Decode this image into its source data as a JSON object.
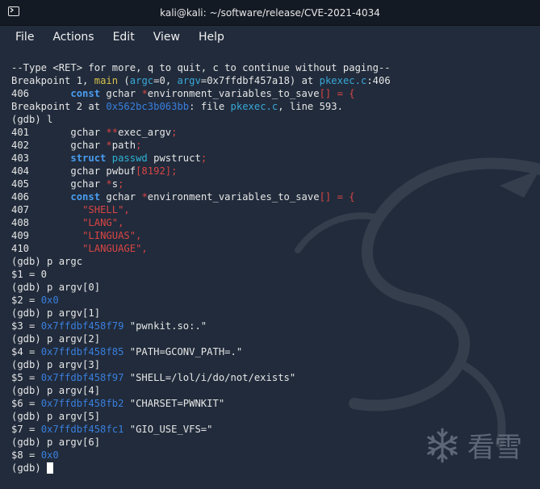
{
  "window": {
    "title": "kali@kali: ~/software/release/CVE-2021-4034"
  },
  "menu": {
    "items": [
      "File",
      "Actions",
      "Edit",
      "View",
      "Help"
    ]
  },
  "icons": {
    "terminal": "terminal-icon",
    "watermark": "snowflake-icon",
    "background": "kali-dragon-icon"
  },
  "watermark": {
    "text": "看雪"
  },
  "colors": {
    "background": "#212b3b",
    "keyword": "#4a9df0",
    "string": "#d94545",
    "address": "#3a7fde",
    "function": "#d6c04c"
  },
  "terminal": {
    "lines": [
      [
        {
          "t": "--Type <RET> for more, q to quit, c to continue without paging--"
        }
      ],
      [
        {
          "t": "Breakpoint 1, "
        },
        {
          "t": "main",
          "c": "fn"
        },
        {
          "t": " ("
        },
        {
          "t": "argc",
          "c": "arg"
        },
        {
          "t": "=0, "
        },
        {
          "t": "argv",
          "c": "arg"
        },
        {
          "t": "=0x7ffdbf457a18) at "
        },
        {
          "t": "pkexec.c",
          "c": "file"
        },
        {
          "t": ":406"
        }
      ],
      [
        {
          "t": "406       "
        },
        {
          "t": "const",
          "c": "kw"
        },
        {
          "t": " gchar "
        },
        {
          "t": "*",
          "c": "str"
        },
        {
          "t": "environment_variables_to_save"
        },
        {
          "t": "[] = {",
          "c": "str"
        }
      ],
      [
        {
          "t": "Breakpoint 2 at "
        },
        {
          "t": "0x562bc3b063bb",
          "c": "addr"
        },
        {
          "t": ": file "
        },
        {
          "t": "pkexec.c",
          "c": "file"
        },
        {
          "t": ", line 593."
        }
      ],
      [
        {
          "t": "(gdb) l"
        }
      ],
      [
        {
          "t": "401       gchar "
        },
        {
          "t": "**",
          "c": "str"
        },
        {
          "t": "exec_argv"
        },
        {
          "t": ";",
          "c": "str"
        }
      ],
      [
        {
          "t": "402       gchar "
        },
        {
          "t": "*",
          "c": "str"
        },
        {
          "t": "path"
        },
        {
          "t": ";",
          "c": "str"
        }
      ],
      [
        {
          "t": "403       "
        },
        {
          "t": "struct",
          "c": "kw"
        },
        {
          "t": " "
        },
        {
          "t": "passwd",
          "c": "ty"
        },
        {
          "t": " pwstruct"
        },
        {
          "t": ";",
          "c": "str"
        }
      ],
      [
        {
          "t": "404       gchar pwbuf"
        },
        {
          "t": "[8192];",
          "c": "str"
        }
      ],
      [
        {
          "t": "405       gchar "
        },
        {
          "t": "*",
          "c": "str"
        },
        {
          "t": "s"
        },
        {
          "t": ";",
          "c": "str"
        }
      ],
      [
        {
          "t": "406       "
        },
        {
          "t": "const",
          "c": "kw"
        },
        {
          "t": " gchar "
        },
        {
          "t": "*",
          "c": "str"
        },
        {
          "t": "environment_variables_to_save"
        },
        {
          "t": "[] = {",
          "c": "str"
        }
      ],
      [
        {
          "t": "407         "
        },
        {
          "t": "\"SHELL\",",
          "c": "str"
        }
      ],
      [
        {
          "t": "408         "
        },
        {
          "t": "\"LANG\",",
          "c": "str"
        }
      ],
      [
        {
          "t": "409         "
        },
        {
          "t": "\"LINGUAS\",",
          "c": "str"
        }
      ],
      [
        {
          "t": "410         "
        },
        {
          "t": "\"LANGUAGE\",",
          "c": "str"
        }
      ],
      [
        {
          "t": "(gdb) p argc"
        }
      ],
      [
        {
          "t": "$1 = 0"
        }
      ],
      [
        {
          "t": "(gdb) p argv[0]"
        }
      ],
      [
        {
          "t": "$2 = "
        },
        {
          "t": "0x0",
          "c": "addr"
        }
      ],
      [
        {
          "t": "(gdb) p argv[1]"
        }
      ],
      [
        {
          "t": "$3 = "
        },
        {
          "t": "0x7ffdbf458f79",
          "c": "addr"
        },
        {
          "t": " \"pwnkit.so:.\""
        }
      ],
      [
        {
          "t": "(gdb) p argv[2]"
        }
      ],
      [
        {
          "t": "$4 = "
        },
        {
          "t": "0x7ffdbf458f85",
          "c": "addr"
        },
        {
          "t": " \"PATH=GCONV_PATH=.\""
        }
      ],
      [
        {
          "t": "(gdb) p argv[3]"
        }
      ],
      [
        {
          "t": "$5 = "
        },
        {
          "t": "0x7ffdbf458f97",
          "c": "addr"
        },
        {
          "t": " \"SHELL=/lol/i/do/not/exists\""
        }
      ],
      [
        {
          "t": "(gdb) p argv[4]"
        }
      ],
      [
        {
          "t": "$6 = "
        },
        {
          "t": "0x7ffdbf458fb2",
          "c": "addr"
        },
        {
          "t": " \"CHARSET=PWNKIT\""
        }
      ],
      [
        {
          "t": "(gdb) p argv[5]"
        }
      ],
      [
        {
          "t": "$7 = "
        },
        {
          "t": "0x7ffdbf458fc1",
          "c": "addr"
        },
        {
          "t": " \"GIO_USE_VFS=\""
        }
      ],
      [
        {
          "t": "(gdb) p argv[6]"
        }
      ],
      [
        {
          "t": "$8 = "
        },
        {
          "t": "0x0",
          "c": "addr"
        }
      ],
      [
        {
          "t": "(gdb) "
        }
      ]
    ]
  }
}
